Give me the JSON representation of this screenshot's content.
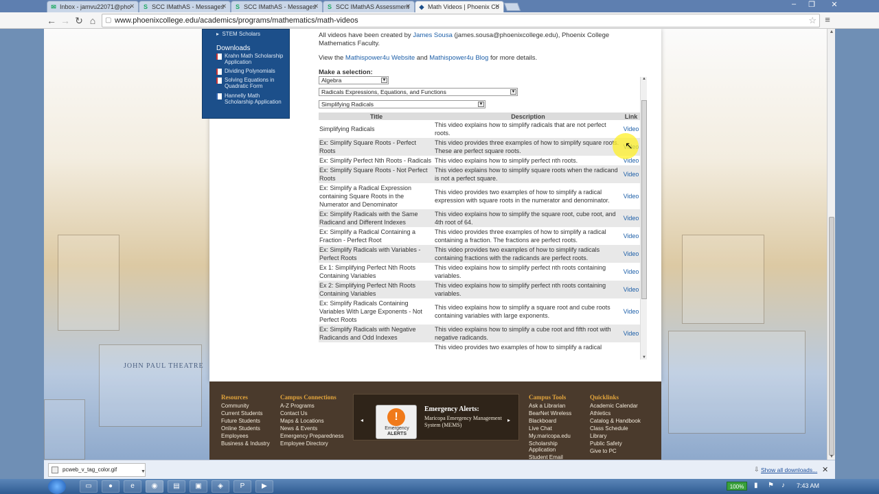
{
  "browser": {
    "tabs": [
      {
        "label": "Inbox - jamvu22071@pho",
        "icon": "mail-icon",
        "active": false
      },
      {
        "label": "SCC IMathAS - Messages",
        "icon": "s-icon",
        "active": false
      },
      {
        "label": "SCC IMathAS - Messages",
        "icon": "s-icon",
        "active": false
      },
      {
        "label": "SCC IMathAS Assessment",
        "icon": "s-icon",
        "active": false
      },
      {
        "label": "Math Videos | Phoenix Co",
        "icon": "pc-icon",
        "active": true
      }
    ],
    "url": "www.phoenixcollege.edu/academics/programs/mathematics/math-videos"
  },
  "sidebar": {
    "top_link": "STEM Scholars",
    "downloads_heading": "Downloads",
    "downloads": [
      "Krahn Math Scholarship Application",
      "Dividing Polynomials",
      "Solving Equations in Quadratic Form",
      "Hannelly Math Scholarship Application"
    ]
  },
  "intro": {
    "line1_pre": "All videos have been created by ",
    "author_link": "James Sousa",
    "line1_post": " (james.sousa@phoenixcollege.edu), Phoenix College",
    "line1_cont": "Mathematics Faculty.",
    "line2_pre": "View the ",
    "website_link": "Mathispower4u Website",
    "line2_and": " and ",
    "blog_link": "Mathispower4u Blog",
    "line2_post": " for more details."
  },
  "selection": {
    "label": "Make a selection:",
    "subject": "Algebra",
    "topic": "Radicals Expressions, Equations, and Functions",
    "subtopic": "Simplifying Radicals"
  },
  "table": {
    "headers": {
      "title": "Title",
      "description": "Description",
      "link": "Link"
    },
    "rows": [
      {
        "title": "Simplifying Radicals",
        "description": "This video explains how to simplify radicals that are not perfect roots.",
        "link": "Video"
      },
      {
        "title": "Ex: Simplify Square Roots - Perfect Roots",
        "description": "This video provides three examples of how to simplify square roots. These are perfect square roots.",
        "link": "Video"
      },
      {
        "title": "Ex: Simplify Perfect Nth Roots - Radicals",
        "description": "This video explains how to simplify perfect nth roots.",
        "link": "Video"
      },
      {
        "title": "Ex: Simplify Square Roots - Not Perfect Roots",
        "description": "This video explains how to simplify square roots when the radicand is not a perfect square.",
        "link": "Video"
      },
      {
        "title": "Ex: Simplify a Radical Expression containing Square Roots in the Numerator and Denominator",
        "description": "This video provides two examples of how to simplify a radical expression with square roots in the numerator and denominator.",
        "link": "Video"
      },
      {
        "title": "Ex: Simplify Radicals with the Same Radicand and Different Indexes",
        "description": "This video explains how to simplify the square root, cube root, and 4th root of 64.",
        "link": "Video"
      },
      {
        "title": "Ex: Simplify a Radical Containing a Fraction - Perfect Root",
        "description": "This video provides three examples of how to simplify a radical containing a fraction. The fractions are perfect roots.",
        "link": "Video"
      },
      {
        "title": "Ex: Simplify Radicals with Variables - Perfect Roots",
        "description": "This video provides two examples of how to simplify radicals containing fractions with the radicands are perfect roots.",
        "link": "Video"
      },
      {
        "title": "Ex 1: Simplifying Perfect Nth Roots Containing Variables",
        "description": "This video explains how to simplify perfect nth roots containing variables.",
        "link": "Video"
      },
      {
        "title": "Ex 2: Simplifying Perfect Nth Roots Containing Variables",
        "description": "This video explains how to simplify perfect nth roots containing variables.",
        "link": "Video"
      },
      {
        "title": "Ex: Simplify Radicals Containing Variables With Large Exponents - Not Perfect Roots",
        "description": "This video explains how to simplify a square root and cube roots containing variables with large exponents.",
        "link": "Video"
      },
      {
        "title": "Ex: Simplify Radicals with Negative Radicands and Odd Indexes",
        "description": "This video explains how to simplify a cube root and fifth root with negative radicands.",
        "link": "Video"
      },
      {
        "title": "",
        "description": "This video provides two examples of how to simplify a radical",
        "link": ""
      }
    ]
  },
  "footer": {
    "resources": {
      "heading": "Resources",
      "items": [
        "Community",
        "Current Students",
        "Future Students",
        "Online Students",
        "Employees",
        "Business & Industry"
      ]
    },
    "connections": {
      "heading": "Campus Connections",
      "items": [
        "A-Z Programs",
        "Contact Us",
        "Maps & Locations",
        "News & Events",
        "Emergency Preparedness",
        "Employee Directory"
      ]
    },
    "alerts": {
      "title": "Emergency Alerts:",
      "text": "Maricopa Emergency Management System (MEMS)",
      "badge_line1": "Emergency",
      "badge_line2": "ALERTS"
    },
    "tools": {
      "heading": "Campus Tools",
      "items": [
        "Ask a Librarian",
        "BearNet Wireless",
        "Blackboard",
        "Live Chat",
        "My.maricopa.edu",
        "Scholarship Application",
        "Student Email"
      ]
    },
    "quicklinks": {
      "heading": "Quicklinks",
      "items": [
        "Academic Calendar",
        "Athletics",
        "Catalog & Handbook",
        "Class Schedule",
        "Library",
        "Public Safety",
        "Give to PC"
      ]
    }
  },
  "background": {
    "building_label": "JOHN PAUL THEATRE"
  },
  "downloads_bar": {
    "file": "pcweb_v_tag_color.gif",
    "show_all": "Show all downloads..."
  },
  "taskbar": {
    "battery": "100%",
    "time": "7:43 AM"
  }
}
